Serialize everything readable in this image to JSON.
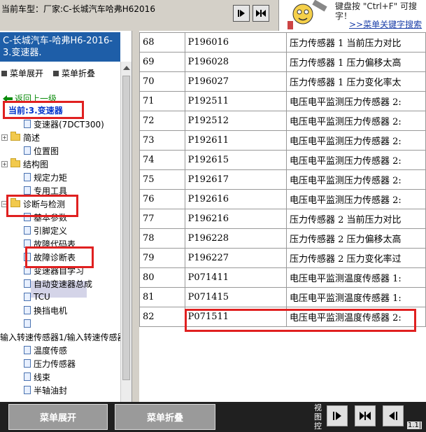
{
  "header": {
    "vehicle_label": "当前车型：厂家:C-长城汽车哈弗H62016",
    "help_text_line1": "键盘按 \"Ctrl+F\" 可搜",
    "help_text_line2": "字！",
    "help_link": ">>菜单关键字搜索"
  },
  "sidebar": {
    "header_title": "C-长城汽车-哈弗H6-2016-3.变速器.",
    "expand_label": "菜单展开",
    "collapse_label": "菜单折叠",
    "back_label": "返回上一级",
    "current_label": "当前:3.变速器",
    "items": [
      {
        "label": "变速器(7DCT300)",
        "type": "doc"
      },
      {
        "label": "简述",
        "type": "folder"
      },
      {
        "label": "位置图",
        "type": "doc"
      },
      {
        "label": "结构图",
        "type": "folder"
      },
      {
        "label": "规定力矩",
        "type": "doc"
      },
      {
        "label": "专用工具",
        "type": "doc"
      },
      {
        "label": "诊断与检测",
        "type": "folder-open"
      },
      {
        "label": "基本参数",
        "type": "doc"
      },
      {
        "label": "引脚定义",
        "type": "doc"
      },
      {
        "label": "故障代码表",
        "type": "doc"
      },
      {
        "label": "故障诊断表",
        "type": "doc"
      },
      {
        "label": "变速器自学习",
        "type": "doc"
      },
      {
        "label": "自动变速器总成",
        "type": "doc"
      },
      {
        "label": "TCU",
        "type": "doc"
      },
      {
        "label": "换挡电机",
        "type": "doc"
      },
      {
        "label": "",
        "type": "doc"
      },
      {
        "label": "输入转速传感器1/输入转速传感器",
        "type": "text"
      },
      {
        "label": "温度传感",
        "type": "doc"
      },
      {
        "label": "压力传感器",
        "type": "doc"
      },
      {
        "label": "线束",
        "type": "doc"
      },
      {
        "label": "半轴油封",
        "type": "doc"
      }
    ]
  },
  "table": {
    "rows": [
      {
        "num": "68",
        "code": "P196016",
        "desc": "压力传感器 1 当前压力对比"
      },
      {
        "num": "69",
        "code": "P196028",
        "desc": "压力传感器 1 压力偏移太高"
      },
      {
        "num": "70",
        "code": "P196027",
        "desc": "压力传感器 1 压力变化率太"
      },
      {
        "num": "71",
        "code": "P192511",
        "desc": "电压电平监测压力传感器 2:"
      },
      {
        "num": "72",
        "code": "P192512",
        "desc": "电压电平监测压力传感器 2:"
      },
      {
        "num": "73",
        "code": "P192611",
        "desc": "电压电平监测压力传感器 2:"
      },
      {
        "num": "74",
        "code": "P192615",
        "desc": "电压电平监测压力传感器 2:"
      },
      {
        "num": "75",
        "code": "P192617",
        "desc": "电压电平监测压力传感器 2:"
      },
      {
        "num": "76",
        "code": "P192616",
        "desc": "电压电平监测压力传感器 2:"
      },
      {
        "num": "77",
        "code": "P196216",
        "desc": "压力传感器 2 当前压力对比"
      },
      {
        "num": "78",
        "code": "P196228",
        "desc": "压力传感器 2 压力偏移太高"
      },
      {
        "num": "79",
        "code": "P196227",
        "desc": "压力传感器 2 压力变化率过"
      },
      {
        "num": "80",
        "code": "P071411",
        "desc": "电压电平监测温度传感器 1:"
      },
      {
        "num": "81",
        "code": "P071415",
        "desc": "电压电平监测温度传感器 1:"
      },
      {
        "num": "82",
        "code": "P071511",
        "desc": "电压电平监测温度传感器 2:"
      }
    ]
  },
  "footer": {
    "expand_button": "菜单展开",
    "collapse_button": "菜单折叠",
    "view_label": "视图控",
    "version": "1.1|"
  },
  "colors": {
    "sidebar_header_bg": "#1e5ea8",
    "highlight_red": "#e02020",
    "current_blue": "#0033cc",
    "back_green": "#0a8a0a"
  }
}
